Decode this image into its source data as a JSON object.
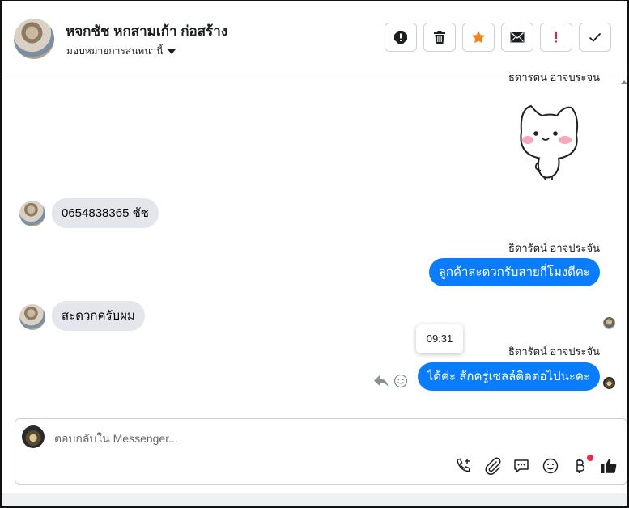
{
  "header": {
    "contact_name": "หจกชัช หกสามเก้า ก่อสร้าง",
    "assign_label": "มอบหมายการสนทนานี้",
    "actions": [
      {
        "name": "spam-button",
        "icon": "report-icon"
      },
      {
        "name": "delete-button",
        "icon": "trash-icon"
      },
      {
        "name": "star-button",
        "icon": "star-icon",
        "color": "#f5811f"
      },
      {
        "name": "mark-unread-button",
        "icon": "envelope-icon"
      },
      {
        "name": "follow-up-button",
        "icon": "exclamation-icon",
        "color": "#e41e3f"
      },
      {
        "name": "mark-done-button",
        "icon": "check-icon"
      }
    ]
  },
  "chat": {
    "messages": [
      {
        "direction": "out",
        "sender": "ธิดารัตน์ อาจประจัน",
        "type": "sticker",
        "sticker": "cat-sticker"
      },
      {
        "direction": "in",
        "text": "0654838365 ชัช"
      },
      {
        "direction": "out",
        "sender": "ธิดารัตน์ อาจประจัน",
        "text": "ลูกค้าสะดวกรับสายกี่โมงดีคะ"
      },
      {
        "direction": "in",
        "text": "สะดวกครับผม"
      },
      {
        "direction": "out",
        "sender": "ธิดารัตน์ อาจประจัน",
        "text": "ได้ค่ะ สักครู่เซลล์ติดต่อไปนะคะ",
        "tooltip_time": "09:31"
      }
    ]
  },
  "composer": {
    "placeholder": "ตอบกลับใน Messenger...",
    "value": "",
    "icons": [
      "add-call-icon",
      "attachment-icon",
      "saved-reply-icon",
      "emoji-icon",
      "payment-icon",
      "like-icon"
    ]
  },
  "colors": {
    "outgoing_bubble": "#0a7cff",
    "incoming_bubble": "#e4e6eb",
    "accent_star": "#f5811f",
    "alert_red": "#e41e3f"
  }
}
